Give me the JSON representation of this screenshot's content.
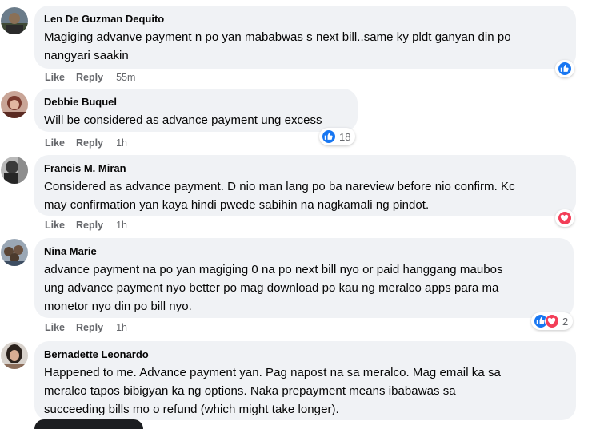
{
  "comments": [
    {
      "author": "Len De Guzman Dequito",
      "text_lines": [
        "Magiging advanve payment n po yan mababwas s next bill..same ky pldt ganyan din po",
        "nangyari saakin"
      ],
      "like": "Like",
      "reply": "Reply",
      "time": "55m",
      "reactions": [
        "like"
      ],
      "reaction_count": ""
    },
    {
      "author": "Debbie Buquel",
      "text_lines": [
        "Will be considered as advance payment ung excess"
      ],
      "like": "Like",
      "reply": "Reply",
      "time": "1h",
      "reactions": [
        "like"
      ],
      "reaction_count": "18"
    },
    {
      "author": "Francis M. Miran",
      "text_lines": [
        "Considered as advance payment. D nio man lang po ba nareview before nio confirm. Kc",
        "may confirmation yan kaya hindi pwede sabihin na nagkamali ng pindot."
      ],
      "like": "Like",
      "reply": "Reply",
      "time": "1h",
      "reactions": [
        "love"
      ],
      "reaction_count": ""
    },
    {
      "author": "Nina Marie",
      "text_lines": [
        "advance payment na po yan magiging 0 na po next bill nyo or paid hanggang maubos",
        "ung advance payment nyo better po mag download po kau ng meralco apps para ma",
        "monetor nyo din po bill nyo."
      ],
      "like": "Like",
      "reply": "Reply",
      "time": "1h",
      "reactions": [
        "like",
        "love"
      ],
      "reaction_count": "2"
    },
    {
      "author": "Bernadette Leonardo",
      "text_lines": [
        "Happened to me. Advance payment yan. Pag napost na sa meralco. Mag email ka sa",
        "meralco tapos bibigyan ka ng options. Naka prepayment means ibabawas sa",
        "succeeding bills mo o refund (which might take longer)."
      ],
      "like": "",
      "reply": "",
      "time": "",
      "reactions": [],
      "reaction_count": ""
    }
  ],
  "colors": {
    "bubble": "#f0f2f5",
    "meta_text": "#65676b",
    "like_blue": "#1877f2",
    "love_red": "#f33e58"
  }
}
